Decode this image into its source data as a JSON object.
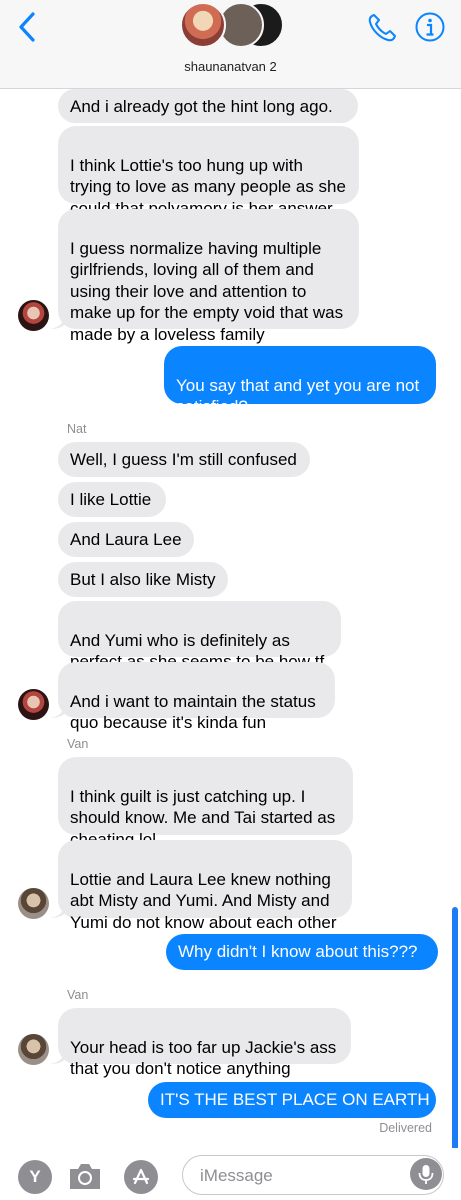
{
  "header": {
    "group_name": "shaunanatvan 2",
    "colors": {
      "accent": "#0a84ff",
      "incoming": "#e9e9eb",
      "outgoing": "#0a84ff"
    }
  },
  "messages": [
    {
      "text": "And i already got the hint long ago."
    },
    {
      "text": "I think Lottie's too hung up with\ntrying to love as many people as she\ncould that polyamory is her answer"
    },
    {
      "text": "I guess normalize having multiple\ngirlfriends, loving all of them and\nusing their love and attention to\nmake up for the empty void that was\nmade by a loveless family"
    },
    {
      "text": "You say that and yet you are not\nsatisfied?"
    },
    {
      "sender": "Nat"
    },
    {
      "text": "Well, I guess I'm still confused"
    },
    {
      "text": "I like Lottie"
    },
    {
      "text": "And Laura Lee"
    },
    {
      "text": "But I also like Misty"
    },
    {
      "text": "And Yumi who is definitely as\nperfect as she seems to be how tf"
    },
    {
      "text": "And i want to maintain the status\nquo because it's kinda fun"
    },
    {
      "sender": "Van"
    },
    {
      "text": "I think guilt is just catching up. I\nshould know. Me and Tai started as\ncheating lol"
    },
    {
      "text": "Lottie and Laura Lee knew nothing\nabt Misty and Yumi. And Misty and\nYumi do not know about each other"
    },
    {
      "text": "Why didn't I know about this???"
    },
    {
      "sender": "Van"
    },
    {
      "text": "Your head is too far up Jackie's ass\nthat you don't notice anything"
    },
    {
      "text": "IT'S THE BEST PLACE ON EARTH"
    }
  ],
  "status": {
    "delivered": "Delivered"
  },
  "composer": {
    "placeholder": "iMessage",
    "app_letter": "Y"
  }
}
